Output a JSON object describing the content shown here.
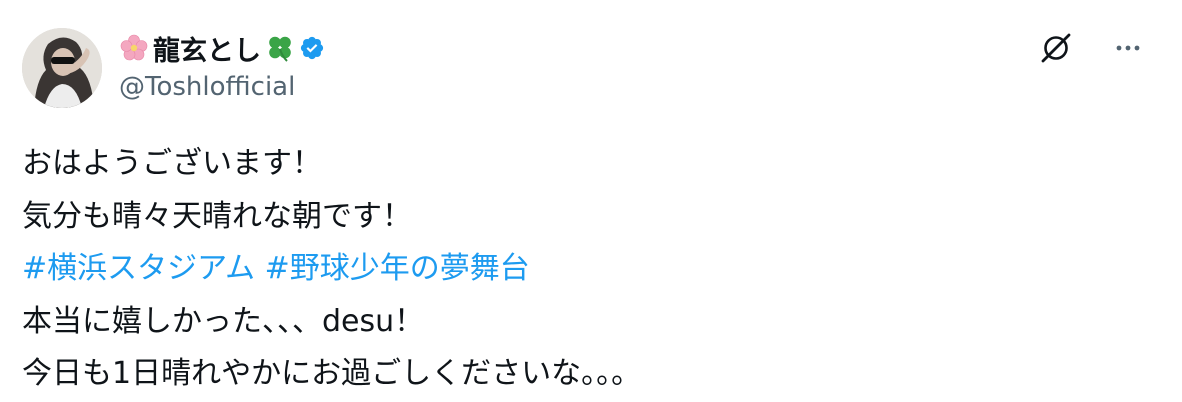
{
  "author": {
    "display_name": "龍玄とし",
    "name_prefix_emoji": "cherry-blossom-icon",
    "name_suffix_emoji": "four-leaf-clover-icon",
    "verified_badge": "verified-badge-icon",
    "handle": "@Toshlofficial"
  },
  "actions": {
    "grok_icon": "grok-icon",
    "more_icon": "more-options-icon",
    "more_label": "···"
  },
  "post": {
    "line1": "おはようございます！",
    "line2": "気分も晴々天晴れな朝です！",
    "hashtags": [
      "#横浜スタジアム",
      "#野球少年の夢舞台"
    ],
    "line4": "本当に嬉しかった、、、desu！",
    "line5": "今日も1日晴れやかにお過ごしくださいな。。。"
  },
  "colors": {
    "text": "#0f1419",
    "secondary": "#536471",
    "link": "#1d9bf0",
    "verified": "#1d9bf0",
    "clover": "#3aa447",
    "blossom": "#f4a7c0"
  }
}
